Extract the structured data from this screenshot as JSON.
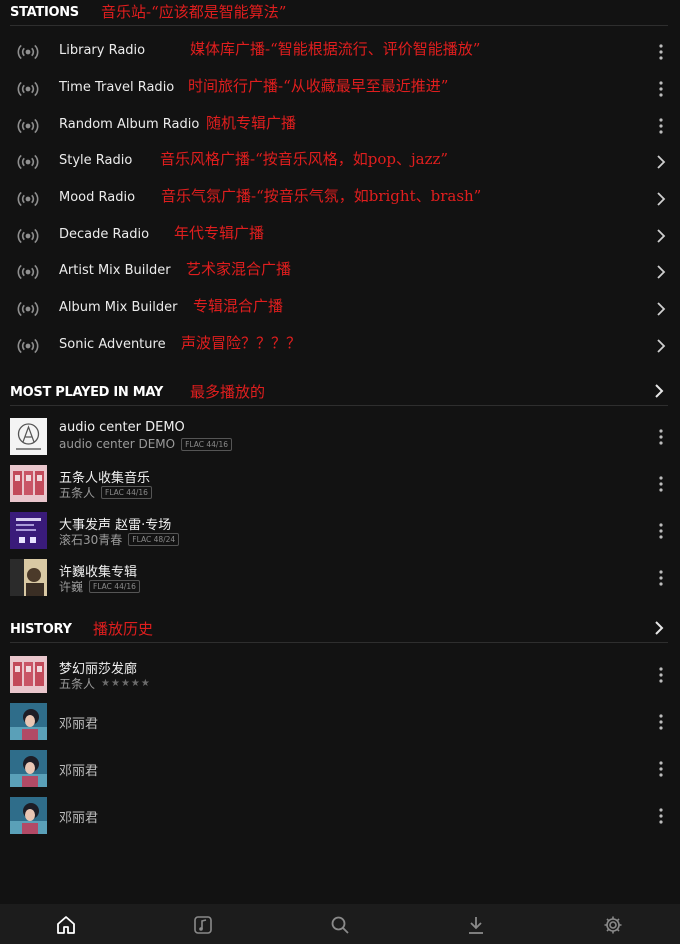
{
  "stations": {
    "title": "STATIONS",
    "note": "音乐站-“应该都是智能算法”",
    "items": [
      {
        "label": "Library Radio",
        "note": "媒体库广播-“智能根据流行、评价智能播放”",
        "trail": "kebab"
      },
      {
        "label": "Time Travel Radio",
        "note": "时间旅行广播-“从收藏最早至最近推进”",
        "trail": "kebab"
      },
      {
        "label": "Random Album Radio",
        "note": "随机专辑广播",
        "trail": "kebab"
      },
      {
        "label": "Style Radio",
        "note": "音乐风格广播-“按音乐风格，如pop、jazz”",
        "trail": "chevron"
      },
      {
        "label": "Mood Radio",
        "note": "音乐气氛广播-“按音乐气氛，如bright、brash”",
        "trail": "chevron"
      },
      {
        "label": "Decade Radio",
        "note": "年代专辑广播",
        "trail": "chevron"
      },
      {
        "label": "Artist Mix Builder",
        "note": "艺术家混合广播",
        "trail": "chevron"
      },
      {
        "label": "Album Mix Builder",
        "note": "专辑混合广播",
        "trail": "chevron"
      },
      {
        "label": "Sonic Adventure",
        "note": "声波冒险？？？？",
        "trail": "chevron"
      }
    ]
  },
  "most_played": {
    "title": "MOST PLAYED IN MAY",
    "note": "最多播放的",
    "items": [
      {
        "title": "audio center DEMO",
        "subtitle": "audio center DEMO",
        "badge": "FLAC 44/16",
        "cover": "audio-technica"
      },
      {
        "title": "五条人收集音乐",
        "subtitle": "五条人",
        "badge": "FLAC 44/16",
        "cover": "pink"
      },
      {
        "title": "大事发声 赵雷·专场",
        "subtitle": "滚石30青春",
        "badge": "FLAC 48/24",
        "cover": "purple"
      },
      {
        "title": "许巍收集专辑",
        "subtitle": "许巍",
        "badge": "FLAC 44/16",
        "cover": "photo"
      }
    ]
  },
  "history": {
    "title": "HISTORY",
    "note": "播放历史",
    "items": [
      {
        "title": "梦幻丽莎发廊",
        "subtitle": "五条人",
        "stars": "★★★★★",
        "cover": "pink"
      },
      {
        "title": "邓丽君",
        "cover": "portrait"
      },
      {
        "title": "邓丽君",
        "cover": "portrait"
      },
      {
        "title": "邓丽君",
        "cover": "portrait"
      }
    ]
  },
  "nav": [
    "home-icon",
    "music-note-icon",
    "search-icon",
    "download-icon",
    "gear-icon"
  ],
  "colors": {
    "accent_note": "#e01e1e",
    "background": "#121212",
    "nav_background": "#1c1c1c"
  }
}
